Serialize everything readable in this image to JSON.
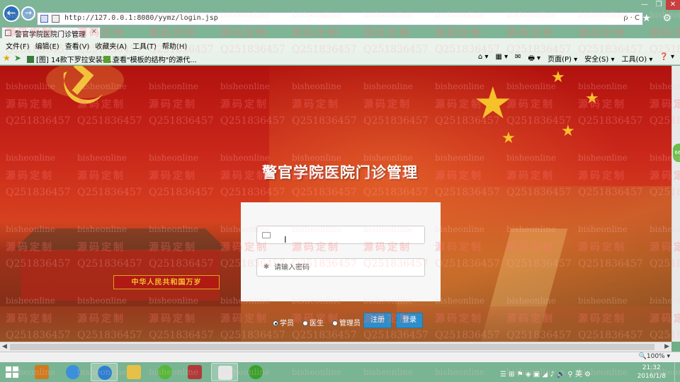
{
  "browser": {
    "url": "http://127.0.0.1:8080/yymz/login.jsp",
    "search_refresh": "ρ · C",
    "window_controls": {
      "minimize": "—",
      "restore": "❐",
      "close": "✕"
    },
    "toolbar_icons": "⌂ ★ ⚙"
  },
  "tab": {
    "title": "警官学院医院门诊管理",
    "close": "×"
  },
  "menu": [
    "文件(F)",
    "编辑(E)",
    "查看(V)",
    "收藏夹(A)",
    "工具(T)",
    "帮助(H)"
  ],
  "favorites": [
    {
      "label": "[图] 14款下罗拉安装板...",
      "color": "#3a7a3a"
    },
    {
      "label": "查看\"模板的结构\"的源代...",
      "color": "#5aa02c"
    }
  ],
  "command_bar": [
    "⌂ ▾",
    "▦ ▾",
    "✉",
    "🖶 ▾",
    "页面(P) ▾",
    "安全(S) ▾",
    "工具(O) ▾",
    "❓ ▾"
  ],
  "page": {
    "title": "警官学院医院门诊管理",
    "banner": "中华人民共和国万岁",
    "username_placeholder": "",
    "password_placeholder": "请输入密码",
    "roles": [
      {
        "label": "学员",
        "selected": true
      },
      {
        "label": "医生",
        "selected": false
      },
      {
        "label": "管理员",
        "selected": false
      }
    ],
    "register_label": "注册",
    "login_label": "登录"
  },
  "watermark": {
    "text_a": "bisheonline",
    "text_b": "源码定制",
    "text_c": "Q251836457"
  },
  "status": {
    "zoom": "🔍100%  ▾"
  },
  "side_badge": "66",
  "taskbar": {
    "time": "21:32",
    "date": "2016/1/8",
    "apps": [
      {
        "name": "book",
        "color": "#d07a20"
      },
      {
        "name": "browser-globe",
        "color": "#3c8fd8"
      },
      {
        "name": "ie",
        "color": "#2f7fd0"
      },
      {
        "name": "file-explorer",
        "color": "#e7c048"
      },
      {
        "name": "green-app",
        "color": "#55b83a"
      },
      {
        "name": "archive",
        "color": "#b03a3a"
      },
      {
        "name": "java",
        "color": "#e8e8e8"
      },
      {
        "name": "wechat",
        "color": "#3aa02c"
      }
    ],
    "tray": "☰ ⊞ ⚑ ◈ ▣ ◢ ♪ 🔊 ⚲ 英 ⚙"
  }
}
